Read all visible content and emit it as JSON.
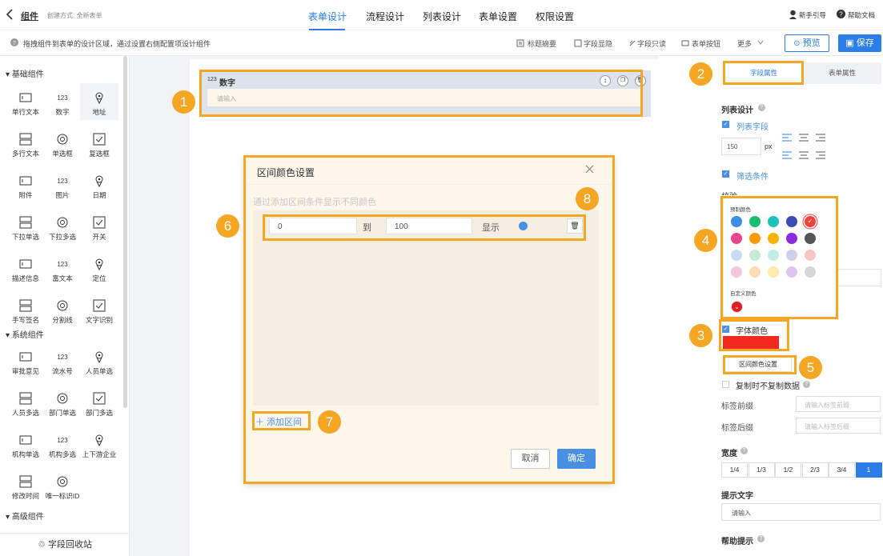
{
  "header": {
    "back_label": "组件",
    "created_by": "创建方式: 全新表单",
    "tabs": [
      "表单设计",
      "流程设计",
      "列表设计",
      "表单设置",
      "权限设置"
    ],
    "guide": "新手引导",
    "help": "帮助文档"
  },
  "subbar": {
    "hint": "拖拽组件到表单的设计区域，通过设置右侧配置项设计组件",
    "actions": [
      "标题摘要",
      "字段显隐",
      "字段只读",
      "表单按钮",
      "更多"
    ],
    "preview": "预览",
    "save": "保存"
  },
  "left": {
    "basic_title": "基础组件",
    "basic": [
      "单行文本",
      "数字",
      "地址",
      "多行文本",
      "单选框",
      "复选框",
      "附件",
      "图片",
      "日期",
      "下拉单选",
      "下拉多选",
      "开关",
      "描述信息",
      "富文本",
      "定位",
      "手写签名",
      "分割线",
      "文字识别"
    ],
    "system_title": "系统组件",
    "system": [
      "审批意见",
      "流水号",
      "人员单选",
      "人员多选",
      "部门单选",
      "部门多选",
      "机构单选",
      "机构多选",
      "上下游企业",
      "修改时间",
      "唯一标识ID"
    ],
    "advanced_title": "高级组件",
    "recycle": "字段回收站"
  },
  "field": {
    "icon_text": "123",
    "label": "数字",
    "placeholder": "请输入"
  },
  "modal": {
    "title": "区间颜色设置",
    "hint": "通过添加区间条件显示不同颜色",
    "row": {
      "from": "0",
      "to_label": "到",
      "to": "100",
      "show_label": "显示",
      "dot_color": "#4a90e2"
    },
    "add": "添加区间",
    "cancel": "取消",
    "ok": "确定"
  },
  "right": {
    "tabs": [
      "字段属性",
      "表单属性"
    ],
    "list_design": "列表设计",
    "list_field": "列表字段",
    "width_value": "150",
    "width_unit": "px",
    "filter": "筛选条件",
    "cut_label": "校验",
    "palette_title": "预制颜色",
    "custom_title": "自定义颜色",
    "palette": [
      "#3a8ee6",
      "#19be6b",
      "#1fc2b8",
      "#3b4bb5",
      "#f0413c",
      "#e8458b",
      "#ff9900",
      "#f5b400",
      "#8a2be2",
      "#555555",
      "#c6dcf0",
      "#c7e9d5",
      "#c3ece9",
      "#cfd1ea",
      "#f6c8c3",
      "#f6c6da",
      "#fbdcb5",
      "#fbeaae",
      "#dcc5f0",
      "#d6d6d6"
    ],
    "font_color_label": "字体颜色",
    "font_color": "#f0281e",
    "range_btn": "区间颜色设置",
    "copy_label": "复制时不复制数据",
    "prefix_label": "标签前缀",
    "prefix_ph": "请输入标签前缀",
    "suffix_label": "标签后缀",
    "suffix_ph": "请输入标签后缀",
    "width_title": "宽度",
    "widths": [
      "1/4",
      "1/3",
      "1/2",
      "2/3",
      "3/4",
      "1"
    ],
    "tip_title": "提示文字",
    "tip_value": "请输入",
    "help_title": "帮助提示"
  },
  "badges": [
    "1",
    "2",
    "3",
    "4",
    "5",
    "6",
    "7",
    "8"
  ],
  "colors": {
    "accent": "#2b7de9",
    "orange": "#f5a623"
  }
}
